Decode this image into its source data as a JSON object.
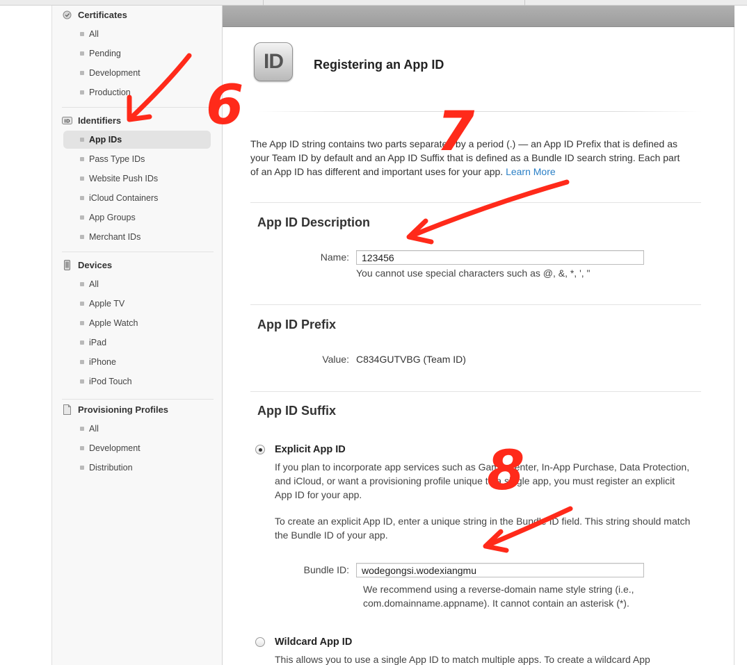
{
  "sidebar": {
    "certificates": {
      "heading": "Certificates",
      "items": [
        "All",
        "Pending",
        "Development",
        "Production"
      ]
    },
    "identifiers": {
      "heading": "Identifiers",
      "items": [
        "App IDs",
        "Pass Type IDs",
        "Website Push IDs",
        "iCloud Containers",
        "App Groups",
        "Merchant IDs"
      ],
      "active_index": 0
    },
    "devices": {
      "heading": "Devices",
      "items": [
        "All",
        "Apple TV",
        "Apple Watch",
        "iPad",
        "iPhone",
        "iPod Touch"
      ]
    },
    "profiles": {
      "heading": "Provisioning Profiles",
      "items": [
        "All",
        "Development",
        "Distribution"
      ]
    }
  },
  "main": {
    "icon_text": "ID",
    "title": "Registering an App ID",
    "intro": "The App ID string contains two parts separated by a period (.) — an App ID Prefix that is defined as your Team ID by default and an App ID Suffix that is defined as a Bundle ID search string. Each part of an App ID has different and important uses for your app.",
    "learn_more": "Learn More",
    "description": {
      "title": "App ID Description",
      "name_label": "Name:",
      "name_value": "123456",
      "name_hint": "You cannot use special characters such as @, &, *, ', \""
    },
    "prefix": {
      "title": "App ID Prefix",
      "value_label": "Value:",
      "value": "C834GUTVBG (Team ID)"
    },
    "suffix": {
      "title": "App ID Suffix",
      "explicit": {
        "title": "Explicit App ID",
        "selected": true,
        "desc1": "If you plan to incorporate app services such as Game Center, In-App Purchase, Data Protection, and iCloud, or want a provisioning profile unique to a single app, you must register an explicit App ID for your app.",
        "desc2": "To create an explicit App ID, enter a unique string in the Bundle ID field. This string should match the Bundle ID of your app.",
        "bundle_label": "Bundle ID:",
        "bundle_value": "wodegongsi.wodexiangmu",
        "bundle_hint": "We recommend using a reverse-domain name style string (i.e., com.domainname.appname). It cannot contain an asterisk (*)."
      },
      "wildcard": {
        "title": "Wildcard App ID",
        "selected": false,
        "desc": "This allows you to use a single App ID to match multiple apps. To create a wildcard App"
      }
    }
  },
  "annotations": {
    "color": "#ff2a1a",
    "labels": [
      "6",
      "7",
      "8"
    ]
  },
  "colors": {
    "link": "#2a7fc6",
    "active_item_bg": "#e3e3e3",
    "topbar": "#a6a6a6"
  }
}
